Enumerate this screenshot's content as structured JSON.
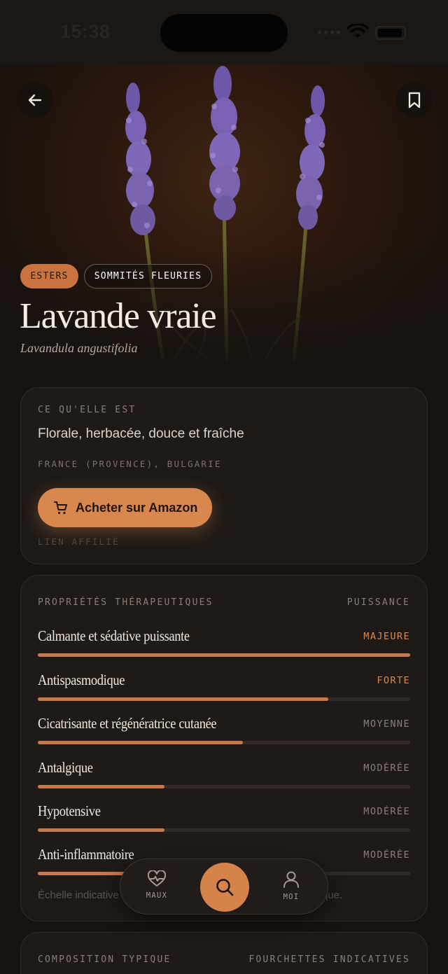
{
  "status_bar": {
    "time": "15:38"
  },
  "hero": {
    "tags": [
      "ESTERS",
      "SOMMITÉS FLEURIES"
    ],
    "title": "Lavande vraie",
    "latin_name": "Lavandula angustifolia",
    "back_icon": "arrow-left-icon",
    "bookmark_icon": "bookmark-icon"
  },
  "overview": {
    "label": "CE QU'ELLE EST",
    "description": "Florale, herbacée, douce et fraîche",
    "origin": "FRANCE (PROVENCE), BULGARIE",
    "buy_button": "Acheter sur Amazon",
    "affiliate_note": "LIEN AFFILIÉ"
  },
  "properties": {
    "title": "PROPRIÉTÉS THÉRAPEUTIQUES",
    "power_label": "PUISSANCE",
    "items": [
      {
        "name": "Calmante et sédative puissante",
        "level": "MAJEURE",
        "strength": 1.0
      },
      {
        "name": "Antispasmodique",
        "level": "FORTE",
        "strength": 0.78
      },
      {
        "name": "Cicatrisante et régénératrice cutanée",
        "level": "MOYENNE",
        "strength": 0.55
      },
      {
        "name": "Antalgique",
        "level": "MODÉRÉE",
        "strength": 0.34
      },
      {
        "name": "Hypotensive",
        "level": "MODÉRÉE",
        "strength": 0.34
      },
      {
        "name": "Anti-inflammatoire",
        "level": "MODÉRÉE",
        "strength": 0.34
      }
    ],
    "scale_note_start": "Échelle indicative",
    "scale_note_end": "que."
  },
  "composition": {
    "title": "COMPOSITION TYPIQUE",
    "range_label": "FOURCHETTES INDICATIVES"
  },
  "nav": {
    "maux": "MAUX",
    "moi": "MOI"
  },
  "colors": {
    "accent": "#d5834a",
    "background": "#171311",
    "card": "#1f1a17"
  }
}
